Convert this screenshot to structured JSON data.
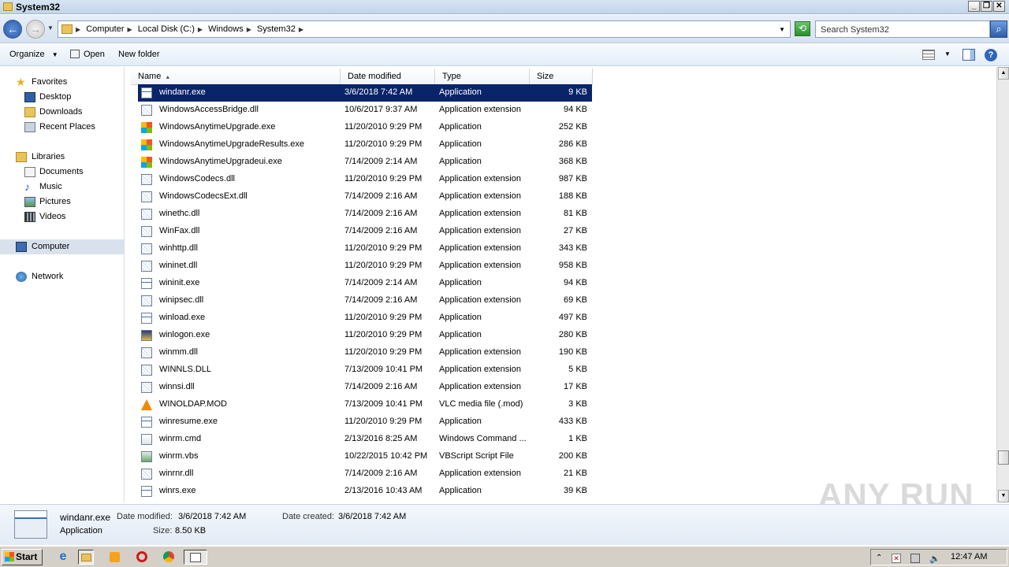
{
  "window": {
    "title": "System32"
  },
  "address": {
    "crumbs": [
      "Computer",
      "Local Disk (C:)",
      "Windows",
      "System32"
    ],
    "search_placeholder": "Search System32"
  },
  "toolbar": {
    "organize": "Organize",
    "open": "Open",
    "new_folder": "New folder"
  },
  "nav": {
    "favorites": "Favorites",
    "desktop": "Desktop",
    "downloads": "Downloads",
    "recent": "Recent Places",
    "libraries": "Libraries",
    "documents": "Documents",
    "music": "Music",
    "pictures": "Pictures",
    "videos": "Videos",
    "computer": "Computer",
    "network": "Network"
  },
  "columns": {
    "name": "Name",
    "date": "Date modified",
    "type": "Type",
    "size": "Size"
  },
  "files": [
    {
      "name": "windanr.exe",
      "date": "3/6/2018 7:42 AM",
      "type": "Application",
      "size": "9 KB",
      "icon": "exe",
      "selected": true
    },
    {
      "name": "WindowsAccessBridge.dll",
      "date": "10/6/2017 9:37 AM",
      "type": "Application extension",
      "size": "94 KB",
      "icon": "dll"
    },
    {
      "name": "WindowsAnytimeUpgrade.exe",
      "date": "11/20/2010 9:29 PM",
      "type": "Application",
      "size": "252 KB",
      "icon": "flag"
    },
    {
      "name": "WindowsAnytimeUpgradeResults.exe",
      "date": "11/20/2010 9:29 PM",
      "type": "Application",
      "size": "286 KB",
      "icon": "flag"
    },
    {
      "name": "WindowsAnytimeUpgradeui.exe",
      "date": "7/14/2009 2:14 AM",
      "type": "Application",
      "size": "368 KB",
      "icon": "flag"
    },
    {
      "name": "WindowsCodecs.dll",
      "date": "11/20/2010 9:29 PM",
      "type": "Application extension",
      "size": "987 KB",
      "icon": "dll"
    },
    {
      "name": "WindowsCodecsExt.dll",
      "date": "7/14/2009 2:16 AM",
      "type": "Application extension",
      "size": "188 KB",
      "icon": "dll"
    },
    {
      "name": "winethc.dll",
      "date": "7/14/2009 2:16 AM",
      "type": "Application extension",
      "size": "81 KB",
      "icon": "dll"
    },
    {
      "name": "WinFax.dll",
      "date": "7/14/2009 2:16 AM",
      "type": "Application extension",
      "size": "27 KB",
      "icon": "dll"
    },
    {
      "name": "winhttp.dll",
      "date": "11/20/2010 9:29 PM",
      "type": "Application extension",
      "size": "343 KB",
      "icon": "dll"
    },
    {
      "name": "wininet.dll",
      "date": "11/20/2010 9:29 PM",
      "type": "Application extension",
      "size": "958 KB",
      "icon": "dll"
    },
    {
      "name": "wininit.exe",
      "date": "7/14/2009 2:14 AM",
      "type": "Application",
      "size": "94 KB",
      "icon": "exe"
    },
    {
      "name": "winipsec.dll",
      "date": "7/14/2009 2:16 AM",
      "type": "Application extension",
      "size": "69 KB",
      "icon": "dll"
    },
    {
      "name": "winload.exe",
      "date": "11/20/2010 9:29 PM",
      "type": "Application",
      "size": "497 KB",
      "icon": "exe"
    },
    {
      "name": "winlogon.exe",
      "date": "11/20/2010 9:29 PM",
      "type": "Application",
      "size": "280 KB",
      "icon": "logon"
    },
    {
      "name": "winmm.dll",
      "date": "11/20/2010 9:29 PM",
      "type": "Application extension",
      "size": "190 KB",
      "icon": "dll"
    },
    {
      "name": "WINNLS.DLL",
      "date": "7/13/2009 10:41 PM",
      "type": "Application extension",
      "size": "5 KB",
      "icon": "dll"
    },
    {
      "name": "winnsi.dll",
      "date": "7/14/2009 2:16 AM",
      "type": "Application extension",
      "size": "17 KB",
      "icon": "dll"
    },
    {
      "name": "WINOLDAP.MOD",
      "date": "7/13/2009 10:41 PM",
      "type": "VLC media file (.mod)",
      "size": "3 KB",
      "icon": "vlc"
    },
    {
      "name": "winresume.exe",
      "date": "11/20/2010 9:29 PM",
      "type": "Application",
      "size": "433 KB",
      "icon": "exe"
    },
    {
      "name": "winrm.cmd",
      "date": "2/13/2016 8:25 AM",
      "type": "Windows Command ...",
      "size": "1 KB",
      "icon": "cmd"
    },
    {
      "name": "winrm.vbs",
      "date": "10/22/2015 10:42 PM",
      "type": "VBScript Script File",
      "size": "200 KB",
      "icon": "vbs"
    },
    {
      "name": "winrnr.dll",
      "date": "7/14/2009 2:16 AM",
      "type": "Application extension",
      "size": "21 KB",
      "icon": "dll"
    },
    {
      "name": "winrs.exe",
      "date": "2/13/2016 10:43 AM",
      "type": "Application",
      "size": "39 KB",
      "icon": "exe"
    }
  ],
  "details": {
    "filename": "windanr.exe",
    "filetype": "Application",
    "modified_label": "Date modified:",
    "modified": "3/6/2018 7:42 AM",
    "created_label": "Date created:",
    "created": "3/6/2018 7:42 AM",
    "size_label": "Size:",
    "size": "8.50 KB"
  },
  "watermark": "ANY RUN",
  "taskbar": {
    "start": "Start",
    "clock": "12:47 AM"
  }
}
